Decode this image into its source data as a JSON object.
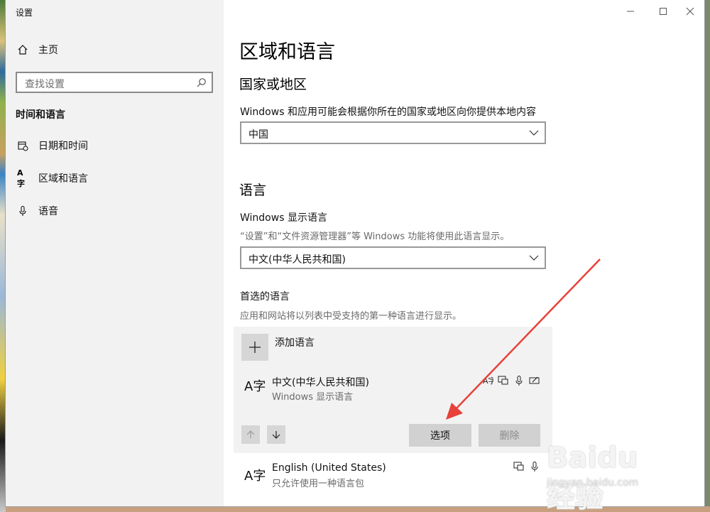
{
  "window": {
    "title": "设置"
  },
  "sidebar": {
    "home_label": "主页",
    "search_placeholder": "查找设置",
    "section_title": "时间和语言",
    "items": [
      {
        "label": "日期和时间",
        "icon": "calendar-clock-icon"
      },
      {
        "label": "区域和语言",
        "icon": "language-icon"
      },
      {
        "label": "语音",
        "icon": "microphone-icon"
      }
    ]
  },
  "content": {
    "title": "区域和语言",
    "region": {
      "heading": "国家或地区",
      "desc": "Windows 和应用可能会根据你所在的国家或地区向你提供本地内容",
      "selected": "中国"
    },
    "language": {
      "heading": "语言",
      "display_label": "Windows 显示语言",
      "display_desc": "“设置”和“文件资源管理器”等 Windows 功能将使用此语言显示。",
      "display_selected": "中文(中华人民共和国)",
      "preferred_label": "首选的语言",
      "preferred_desc": "应用和网站将以列表中受支持的第一种语言进行显示。",
      "add_label": "添加语言",
      "icon_glyph": "A字",
      "list": [
        {
          "name": "中文(中华人民共和国)",
          "sub": "Windows 显示语言"
        },
        {
          "name": "English (United States)",
          "sub": "只允许使用一种语言包"
        }
      ],
      "options_button": "选项",
      "remove_button": "删除"
    }
  },
  "watermark": {
    "brand": "Baidu 经验",
    "url": "jingyan.baidu.com"
  },
  "colors": {
    "sidebar_bg": "#f2f2f2",
    "panel_bg": "#f2f2f2",
    "annotation_arrow": "#e8413a"
  }
}
